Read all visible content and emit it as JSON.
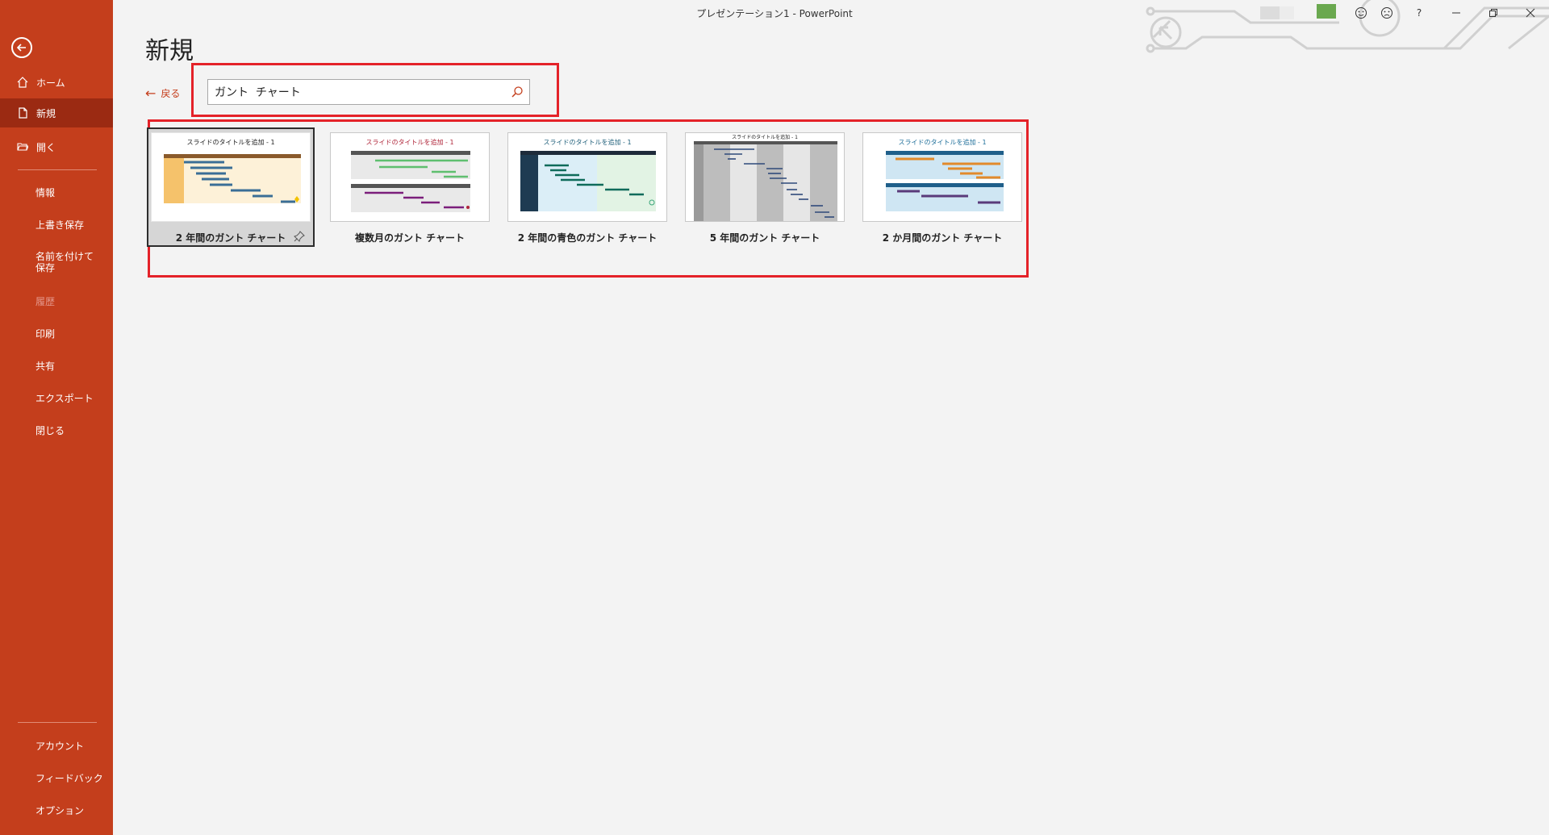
{
  "window": {
    "title": "プレゼンテーション1  -  PowerPoint"
  },
  "sidebar": {
    "items": [
      {
        "label": "ホーム",
        "icon": "home-icon"
      },
      {
        "label": "新規",
        "icon": "new-document-icon",
        "active": true
      },
      {
        "label": "開く",
        "icon": "open-folder-icon"
      },
      {
        "label": "情報"
      },
      {
        "label": "上書き保存"
      },
      {
        "label": "名前を付けて保存"
      },
      {
        "label": "履歴",
        "disabled": true
      },
      {
        "label": "印刷"
      },
      {
        "label": "共有"
      },
      {
        "label": "エクスポート"
      },
      {
        "label": "閉じる"
      }
    ],
    "bottom_items": [
      {
        "label": "アカウント"
      },
      {
        "label": "フィードバック"
      },
      {
        "label": "オプション"
      }
    ]
  },
  "main": {
    "title": "新規",
    "back_label": "戻る",
    "search": {
      "value": "ガント  チャート"
    },
    "templates": [
      {
        "label": "2 年間のガント チャート",
        "thumb_title": "スライドのタイトルを追加 - 1",
        "accent": "#3a6e96",
        "title_color": "#222222",
        "selected": true
      },
      {
        "label": "複数月のガント チャート",
        "thumb_title": "スライドのタイトルを追加 - 1",
        "accent": "#5fbf6f",
        "title_color": "#b0263a"
      },
      {
        "label": "2 年間の青色のガント チャート",
        "thumb_title": "スライドのタイトルを追加 - 1",
        "accent": "#0e6b5a",
        "title_color": "#1f5f7a"
      },
      {
        "label": "5 年間のガント チャート",
        "thumb_title": "スライドのタイトルを追加 - 1",
        "accent": "#2f4a7a",
        "title_color": "#222222"
      },
      {
        "label": "2 か月間のガント チャート",
        "thumb_title": "スライドのタイトルを追加 - 1",
        "accent": "#e28a2b",
        "title_color": "#1f6f9a"
      }
    ]
  },
  "window_controls": {
    "help": "?"
  },
  "colors": {
    "sidebar": "#c43e1c",
    "sidebar_active": "#9b2a12",
    "annotation": "#e42229"
  }
}
